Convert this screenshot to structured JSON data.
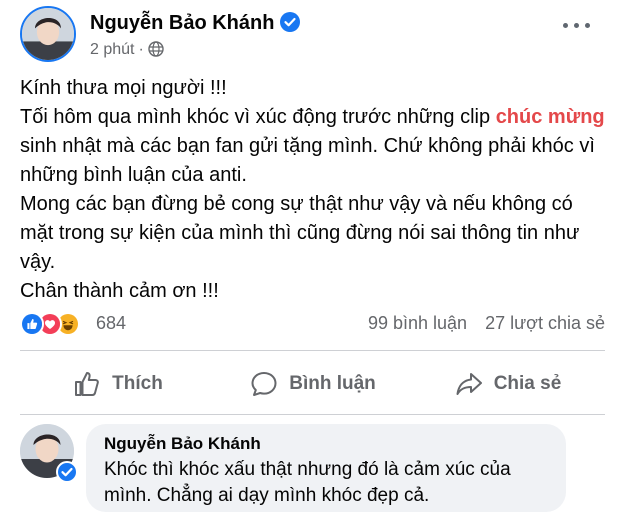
{
  "post": {
    "author": "Nguyễn Bảo Khánh",
    "time": "2 phút",
    "separator": "·",
    "paragraphs": [
      {
        "parts": [
          {
            "text": "Kính thưa mọi người !!!"
          }
        ]
      },
      {
        "parts": [
          {
            "text": "Tối hôm qua mình khóc vì xúc động trước những clip "
          },
          {
            "text": "chúc mừng",
            "highlight": true
          },
          {
            "text": " sinh nhật mà các bạn fan gửi tặng mình. Chứ không phải khóc vì những bình luận của anti."
          }
        ]
      },
      {
        "parts": [
          {
            "text": "Mong các bạn đừng bẻ cong sự thật như vậy và nếu không có mặt trong sự kiện của mình thì cũng đừng nói sai thông tin như vậy."
          }
        ]
      },
      {
        "parts": [
          {
            "text": "Chân thành cảm ơn !!!"
          }
        ]
      }
    ]
  },
  "reactions": {
    "icons": [
      "like",
      "love",
      "haha"
    ],
    "count": "684",
    "comments": "99 bình luận",
    "shares": "27 lượt chia sẻ"
  },
  "actions": {
    "like": "Thích",
    "comment": "Bình luận",
    "share": "Chia sẻ"
  },
  "comment": {
    "author": "Nguyễn Bảo Khánh",
    "text": "Khóc thì khóc xấu thật nhưng đó là cảm xúc của mình. Chẳng ai dạy mình khóc đẹp cả."
  },
  "colors": {
    "brand_blue": "#1877f2",
    "highlight_red": "#e4484a",
    "muted_text": "#65676b",
    "love_red": "#f33e58",
    "haha_yellow": "#f7b125",
    "bubble_gray": "#f0f2f5"
  }
}
